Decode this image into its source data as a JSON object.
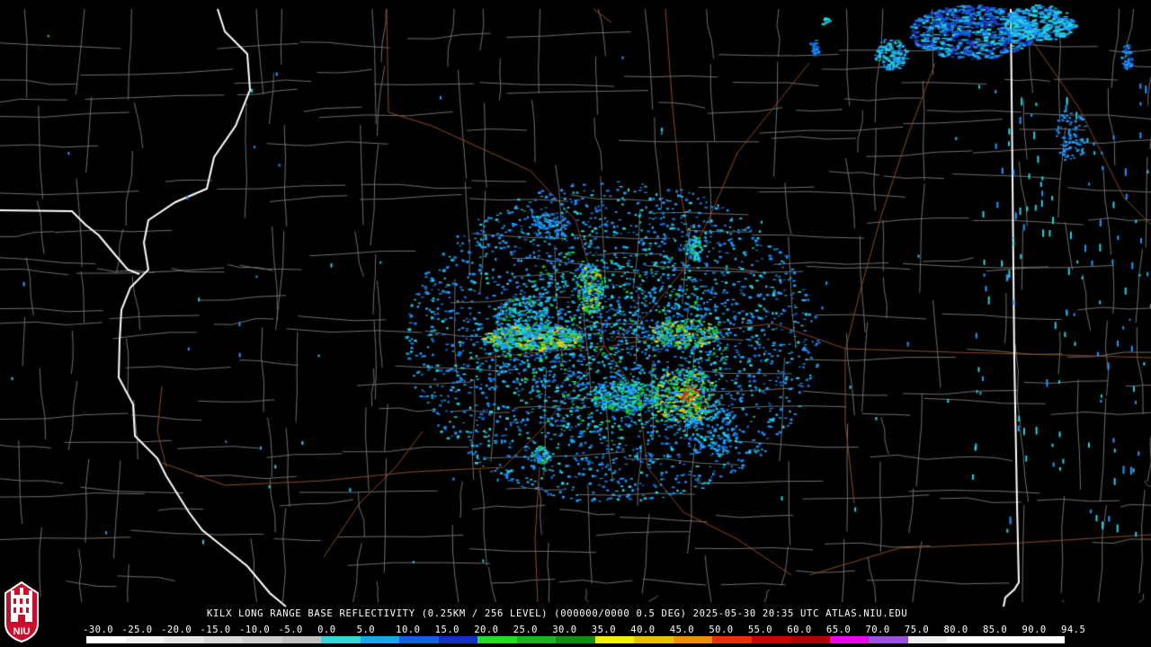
{
  "title": "KILX LONG RANGE BASE REFLECTIVITY (0.25KM / 256 LEVEL) (000000/0000 0.5 DEG) 2025-05-30 20:35 UTC  ATLAS.NIU.EDU",
  "logo_text": "NIU",
  "scale": {
    "labels": [
      "-30.0",
      "-25.0",
      "-20.0",
      "-15.0",
      "-10.0",
      "-5.0",
      "0.0",
      "5.0",
      "10.0",
      "15.0",
      "20.0",
      "25.0",
      "30.0",
      "35.0",
      "40.0",
      "45.0",
      "50.0",
      "55.0",
      "60.0",
      "65.0",
      "70.0",
      "75.0",
      "80.0",
      "85.0",
      "90.0",
      "94.5"
    ],
    "colors": [
      "#ffffff",
      "#f2f2f2",
      "#e6e6e6",
      "#d9d9d9",
      "#cccccc",
      "#bfbfbf",
      "#2fd8d8",
      "#18a8f0",
      "#1060e8",
      "#1030c8",
      "#20e020",
      "#18b818",
      "#109010",
      "#f0f000",
      "#e8c000",
      "#f09000",
      "#f03000",
      "#d00000",
      "#b00000",
      "#f000f0",
      "#a050e0",
      "#f0f0f0",
      "#ffffff",
      "#ffffff",
      "#ffffff"
    ]
  },
  "colors": {
    "background": "#000000",
    "county_lines": "#6e6e6e",
    "state_lines": "#ffffff",
    "roads": "#8a4a2a",
    "echo_light": "#1e9bff",
    "echo_cyan": "#22d4e0",
    "echo_green": "#20c020",
    "echo_yellow": "#e8d000",
    "echo_red": "#e03020"
  },
  "map": {
    "radar_site": "KILX",
    "state_boundaries": [
      "mississippi-river-west",
      "indiana-border-east",
      "missouri-iowa-north-west"
    ]
  }
}
